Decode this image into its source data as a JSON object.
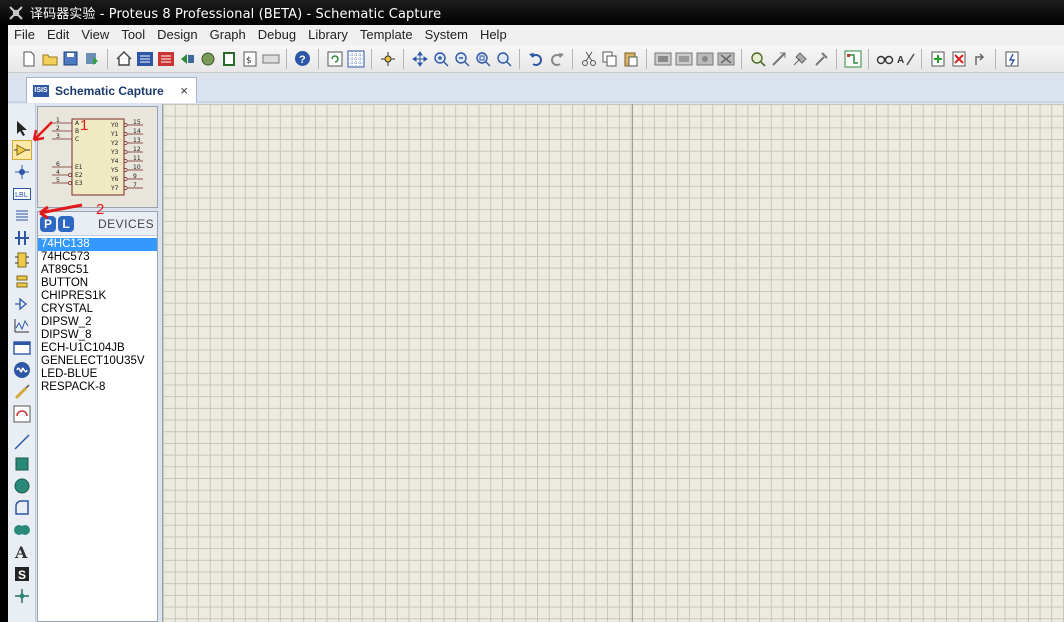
{
  "window": {
    "title": "译码器实验 - Proteus 8 Professional (BETA) - Schematic Capture"
  },
  "menu": [
    "File",
    "Edit",
    "View",
    "Tool",
    "Design",
    "Graph",
    "Debug",
    "Library",
    "Template",
    "System",
    "Help"
  ],
  "tab": {
    "label": "Schematic Capture",
    "close": "×"
  },
  "device_panel": {
    "pick_button": "P",
    "library_button": "L",
    "title": "DEVICES",
    "selected": "74HC138",
    "items": [
      "74HC138",
      "74HC573",
      "AT89C51",
      "BUTTON",
      "CHIPRES1K",
      "CRYSTAL",
      "DIPSW_2",
      "DIPSW_8",
      "ECH-U1C104JB",
      "GENELECT10U35V",
      "LED-BLUE",
      "RESPACK-8"
    ]
  },
  "preview": {
    "left_pins": [
      "1",
      "2",
      "3",
      "6",
      "4",
      "5"
    ],
    "left_labels": [
      "A",
      "B",
      "C",
      "E1",
      "E2",
      "E3"
    ],
    "right_labels": [
      "Y0",
      "Y1",
      "Y2",
      "Y3",
      "Y4",
      "Y5",
      "Y6",
      "Y7"
    ],
    "right_pins": [
      "15",
      "14",
      "13",
      "12",
      "11",
      "10",
      "9",
      "7"
    ]
  },
  "annotations": {
    "one": "1",
    "two": "2"
  },
  "colors": {
    "title_bar": "#000000",
    "selection": "#3399ff",
    "annotation": "#e01a1a",
    "grid_bg": "#ecebe0"
  }
}
